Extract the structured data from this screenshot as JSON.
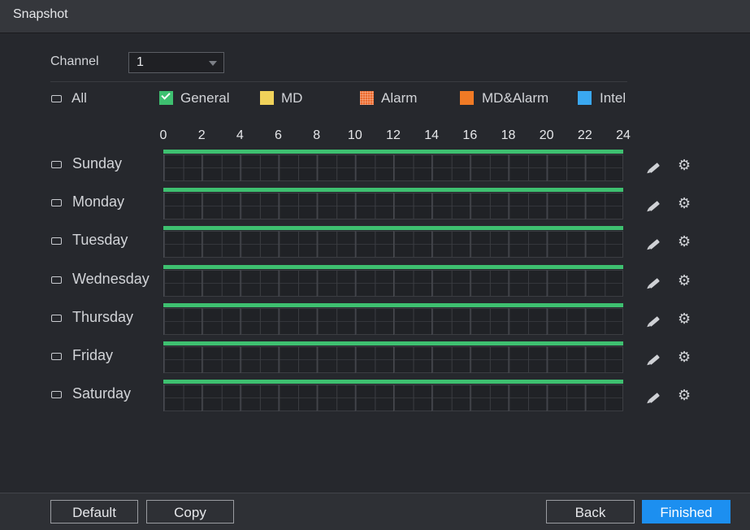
{
  "window": {
    "title": "Snapshot"
  },
  "channel": {
    "label": "Channel",
    "value": "1"
  },
  "all_label": "All",
  "legend": [
    {
      "label": "General",
      "color": "#3ec070",
      "checked": true
    },
    {
      "label": "MD",
      "color": "#f0d25a",
      "checked": false
    },
    {
      "label": "Alarm",
      "color": "#ec6a2c",
      "checked": false
    },
    {
      "label": "MD&Alarm",
      "color": "#f07a25",
      "checked": false
    },
    {
      "label": "Intel",
      "color": "#3aa8f0",
      "checked": false
    }
  ],
  "hours": [
    "0",
    "2",
    "4",
    "6",
    "8",
    "10",
    "12",
    "14",
    "16",
    "18",
    "20",
    "22",
    "24"
  ],
  "days": [
    {
      "label": "Sunday",
      "record": "General",
      "start": 0,
      "end": 24
    },
    {
      "label": "Monday",
      "record": "General",
      "start": 0,
      "end": 24
    },
    {
      "label": "Tuesday",
      "record": "General",
      "start": 0,
      "end": 24
    },
    {
      "label": "Wednesday",
      "record": "General",
      "start": 0,
      "end": 24
    },
    {
      "label": "Thursday",
      "record": "General",
      "start": 0,
      "end": 24
    },
    {
      "label": "Friday",
      "record": "General",
      "start": 0,
      "end": 24
    },
    {
      "label": "Saturday",
      "record": "General",
      "start": 0,
      "end": 24
    }
  ],
  "icons": {
    "edit": "pencil-icon",
    "settings": "gear-icon"
  },
  "buttons": {
    "default": "Default",
    "copy": "Copy",
    "back": "Back",
    "finished": "Finished"
  }
}
